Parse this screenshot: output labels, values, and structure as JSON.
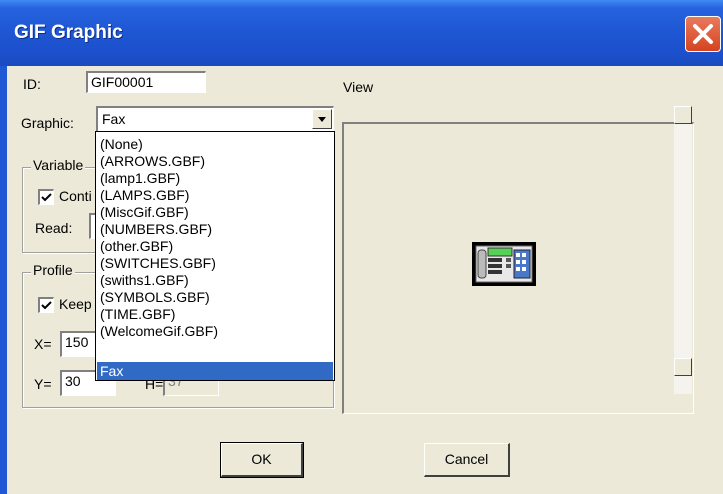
{
  "window": {
    "title": "GIF Graphic"
  },
  "form": {
    "id_label": "ID:",
    "id_value": "GIF00001",
    "view_label": "View",
    "graphic_label": "Graphic:",
    "graphic_value": "Fax"
  },
  "variable_group": {
    "title": "Variable",
    "continuous_label": "Conti",
    "continuous_checked": true,
    "read_label": "Read:"
  },
  "profile_group": {
    "title": "Profile",
    "keep_label": "Keep",
    "keep_checked": true,
    "x_label": "X=",
    "x_value": "150",
    "y_label": "Y=",
    "y_value": "30",
    "h_label": "H=",
    "h_value": "37"
  },
  "dropdown": {
    "items": [
      "(None)",
      "(ARROWS.GBF)",
      "(lamp1.GBF)",
      "(LAMPS.GBF)",
      "(MiscGif.GBF)",
      "(NUMBERS.GBF)",
      "(other.GBF)",
      "(SWITCHES.GBF)",
      "(swiths1.GBF)",
      "(SYMBOLS.GBF)",
      "(TIME.GBF)",
      "(WelcomeGif.GBF)",
      "Fax"
    ],
    "selected_index": 12
  },
  "buttons": {
    "ok": "OK",
    "cancel": "Cancel"
  },
  "colors": {
    "titlebar": "#1f57d4",
    "selection": "#316ac5",
    "dialog": "#ece9d8",
    "close": "#d5431f"
  },
  "icons": {
    "close": "close-icon",
    "preview": "fax-machine-icon"
  }
}
